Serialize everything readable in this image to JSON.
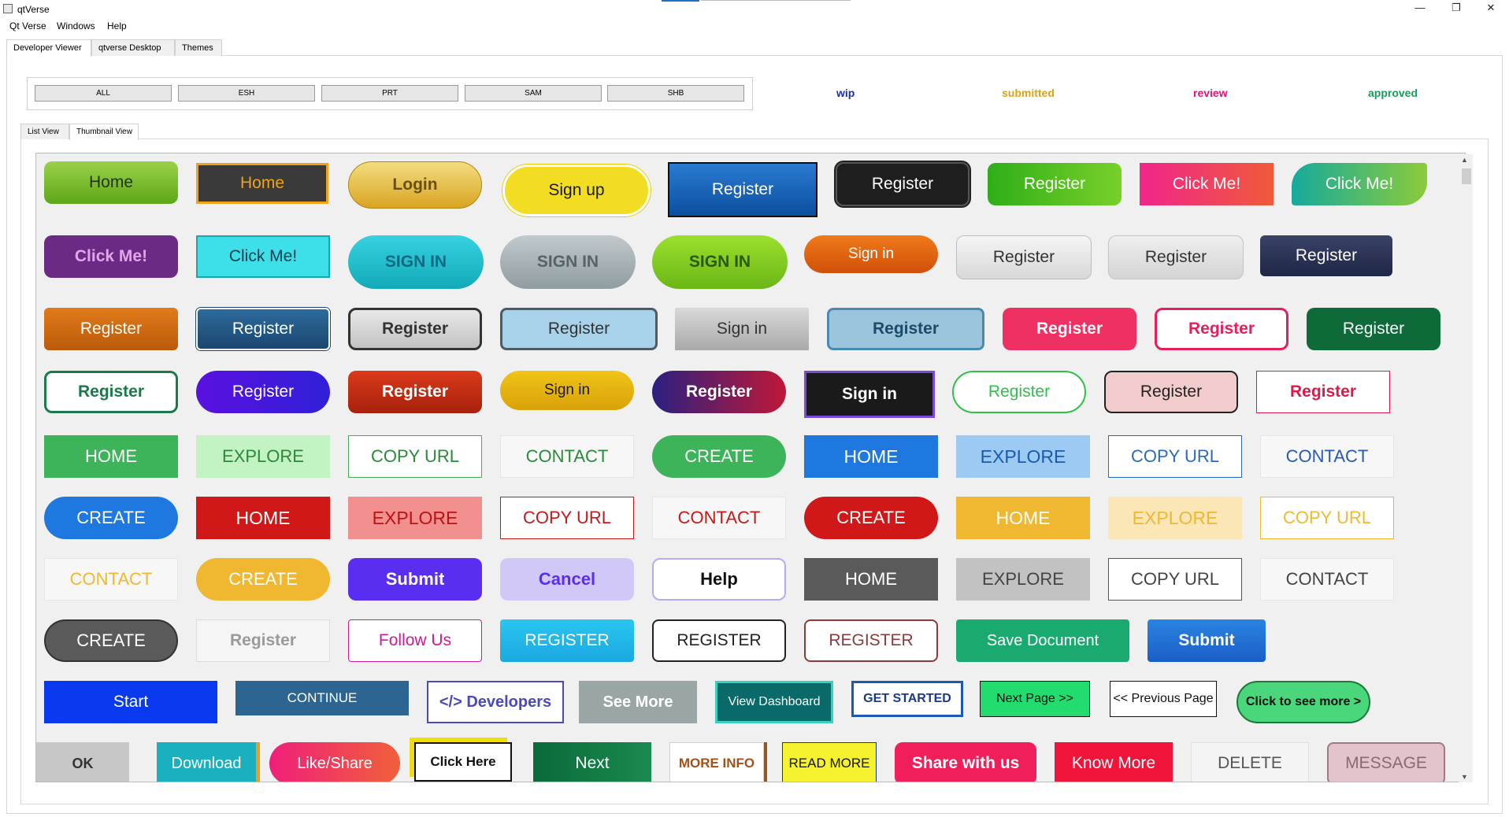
{
  "window": {
    "title": "qtVerse",
    "min_glyph": "—",
    "max_glyph": "❐",
    "close_glyph": "✕"
  },
  "menu": [
    "Qt Verse",
    "Windows",
    "Help"
  ],
  "outer_tabs": [
    "Developer Viewer",
    "qtverse Desktop",
    "Themes"
  ],
  "filters": [
    "ALL",
    "ESH",
    "PRT",
    "SAM",
    "SHB"
  ],
  "statuses": [
    {
      "label": "wip",
      "color": "#1f2f9f"
    },
    {
      "label": "submitted",
      "color": "#d9a21b"
    },
    {
      "label": "review",
      "color": "#e0127c"
    },
    {
      "label": "approved",
      "color": "#1a9c5a"
    }
  ],
  "inner_tabs": [
    "List View",
    "Thumbnail View"
  ],
  "scroll": {
    "up_glyph": "▲",
    "down_glyph": "▼"
  },
  "rows": [
    [
      "Home",
      "Home",
      "Login",
      "Sign up",
      "Register",
      "Register",
      "Register",
      "Click Me!",
      "Click Me!"
    ],
    [
      "Click Me!",
      "Click Me!",
      "SIGN IN",
      "SIGN IN",
      "SIGN IN",
      "Sign in",
      "Register",
      "Register",
      "Register"
    ],
    [
      "Register",
      "Register",
      "Register",
      "Register",
      "Sign in",
      "Register",
      "Register",
      "Register",
      "Register"
    ],
    [
      "Register",
      "Register",
      "Register",
      "Sign in",
      "Register",
      "Sign in",
      "Register",
      "Register",
      "Register"
    ],
    [
      "HOME",
      "EXPLORE",
      "COPY URL",
      "CONTACT",
      "CREATE",
      "HOME",
      "EXPLORE",
      "COPY URL",
      "CONTACT"
    ],
    [
      "CREATE",
      "HOME",
      "EXPLORE",
      "COPY URL",
      "CONTACT",
      "CREATE",
      "HOME",
      "EXPLORE",
      "COPY URL"
    ],
    [
      "CONTACT",
      "CREATE",
      "Submit",
      "Cancel",
      "Help",
      "HOME",
      "EXPLORE",
      "COPY URL",
      "CONTACT"
    ],
    [
      "CREATE",
      "Register",
      "Follow Us",
      "REGISTER",
      "REGISTER",
      "REGISTER",
      "Save Document",
      "Submit"
    ],
    [
      "Start",
      "CONTINUE",
      "</> Developers",
      "See More",
      "View Dashboard",
      "GET STARTED",
      "Next Page >>",
      "<< Previous Page",
      "Click to see more >"
    ],
    [
      "OK",
      "Download",
      "Like/Share",
      "Click Here",
      "Next",
      "MORE INFO",
      "READ MORE",
      "Share with us",
      "Know More",
      "DELETE",
      "MESSAGE"
    ]
  ]
}
